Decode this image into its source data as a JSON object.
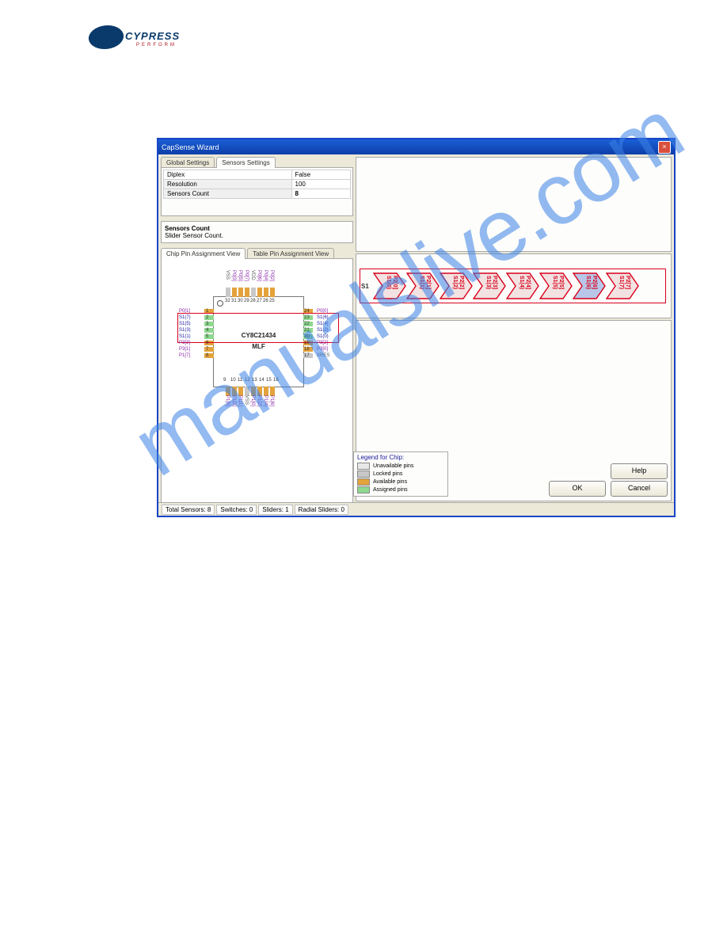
{
  "logo": {
    "brand": "CYPRESS",
    "sub": "PERFORM"
  },
  "window": {
    "title": "CapSense Wizard",
    "close": "×"
  },
  "tabs": {
    "left": [
      "Global Settings",
      "Sensors Settings"
    ],
    "chip": [
      "Chip Pin Assignment View",
      "Table Pin Assignment View"
    ]
  },
  "settings": {
    "rows": [
      {
        "k": "Diplex",
        "v": "False"
      },
      {
        "k": "Resolution",
        "v": "100"
      },
      {
        "k": "Sensors Count",
        "v": "8"
      }
    ],
    "desc_title": "Sensors Count",
    "desc_body": "Slider Sensor Count."
  },
  "chip": {
    "name": "CY8C21434",
    "pkg": "MLF",
    "top": {
      "nums": [
        "32",
        "31",
        "30",
        "29",
        "28",
        "27",
        "26",
        "25"
      ],
      "lbls": [
        "VSS",
        "P0[3]",
        "P0[5]",
        "P0[7]",
        "VDD",
        "P0[6]",
        "P0[4]",
        "P0[2]"
      ]
    },
    "left": {
      "nums": [
        "1",
        "2",
        "3",
        "4",
        "5",
        "6",
        "7",
        "8"
      ],
      "lbls": [
        "P0[1]",
        "S1(7)",
        "S1(5)",
        "S1(3)",
        "S1(1)",
        "P3[3]",
        "P3[1]",
        "P1[7]"
      ]
    },
    "right": {
      "nums": [
        "24",
        "23",
        "22",
        "21",
        "20",
        "19",
        "18",
        "17"
      ],
      "lbls": [
        "P0[0]",
        "S1(6)",
        "S1(4)",
        "S1(2)",
        "S1(0)",
        "P3[2]",
        "P3[0]",
        "XRES"
      ]
    },
    "bottom": {
      "nums": [
        "9",
        "10",
        "11",
        "12",
        "13",
        "14",
        "15",
        "16"
      ],
      "lbls": [
        "P1[5]",
        "P1[3]",
        "P1[1]",
        "VSS",
        "P1[0]",
        "P1[2]",
        "P1[4]",
        "P1[6]"
      ]
    }
  },
  "legend": {
    "title": "Legend for Chip:",
    "items": [
      {
        "c": "#e8e8e8",
        "t": "Unavailable pins"
      },
      {
        "c": "#c8c8c8",
        "t": "Locked pins"
      },
      {
        "c": "#e3a23a",
        "t": "Available pins"
      },
      {
        "c": "#8fd88f",
        "t": "Assigned pins"
      }
    ]
  },
  "sensors": {
    "label": "S1",
    "items": [
      {
        "s": "S1(0)",
        "p": "P2[0]"
      },
      {
        "s": "S1(1)",
        "p": "P2[1]"
      },
      {
        "s": "S1(2)",
        "p": "P2[2]"
      },
      {
        "s": "S1(3)",
        "p": "P2[3]"
      },
      {
        "s": "S1(4)",
        "p": "P2[4]"
      },
      {
        "s": "S1(5)",
        "p": "P2[5]"
      },
      {
        "s": "S1(6)",
        "p": "P2[6]"
      },
      {
        "s": "S1(7)",
        "p": "P2[7]"
      }
    ]
  },
  "buttons": {
    "help": "Help",
    "ok": "OK",
    "cancel": "Cancel"
  },
  "status": {
    "total": "Total Sensors: 8",
    "sw": "Switches: 0",
    "sl": "Sliders: 1",
    "rs": "Radial Sliders: 0"
  },
  "watermark": "manualslive.com"
}
